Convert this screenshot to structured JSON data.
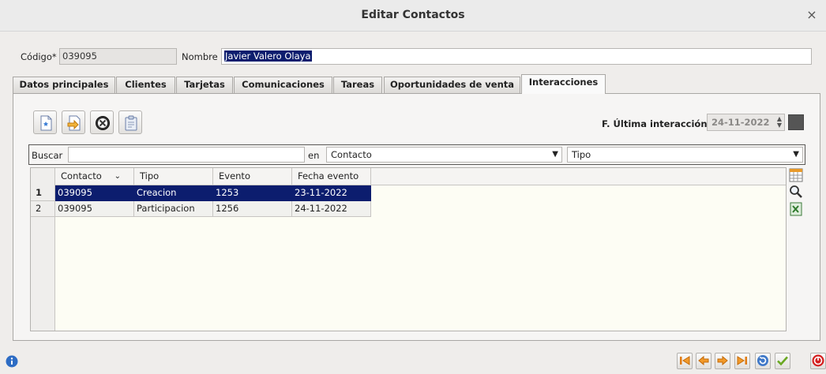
{
  "window": {
    "title": "Editar Contactos",
    "close_glyph": "×"
  },
  "header": {
    "codigo_label": "Código*",
    "codigo_value": "039095",
    "nombre_label": "Nombre",
    "nombre_value": "Javier Valero Olaya"
  },
  "tabs": [
    {
      "label": "Datos principales",
      "active": false
    },
    {
      "label": "Clientes",
      "active": false
    },
    {
      "label": "Tarjetas",
      "active": false
    },
    {
      "label": "Comunicaciones",
      "active": false
    },
    {
      "label": "Tareas",
      "active": false
    },
    {
      "label": "Oportunidades de venta",
      "active": false
    },
    {
      "label": "Interacciones",
      "active": true
    }
  ],
  "toolbar": {
    "icons": [
      "new-document-icon",
      "edit-document-icon",
      "delete-icon",
      "clipboard-icon"
    ]
  },
  "ultima_interaccion": {
    "label": "F. Última interacción",
    "value": "24-11-2022"
  },
  "search": {
    "label": "Buscar",
    "value": "",
    "en_label": "en",
    "field_select": "Contacto",
    "type_select": "Tipo"
  },
  "grid": {
    "columns": [
      "Contacto",
      "Tipo",
      "Evento",
      "Fecha evento"
    ],
    "rows": [
      {
        "num": "1",
        "contacto": "039095",
        "tipo": "Creacion",
        "evento": "1253",
        "fecha": "23-11-2022",
        "selected": true
      },
      {
        "num": "2",
        "contacto": "039095",
        "tipo": "Participacion",
        "evento": "1256",
        "fecha": "24-11-2022",
        "selected": false
      }
    ]
  },
  "side_icons": [
    "columns-config-icon",
    "magnifier-icon",
    "excel-export-icon"
  ],
  "statusbar": {
    "info_icon": "info-icon",
    "nav_icons": [
      "first-record-icon",
      "previous-record-icon",
      "next-record-icon",
      "last-record-icon",
      "refresh-icon",
      "accept-icon",
      "cancel-icon"
    ]
  },
  "colors": {
    "selection": "#0c1d6e",
    "grid_bg": "#fdfdf4",
    "window_bg": "#efedeb"
  }
}
